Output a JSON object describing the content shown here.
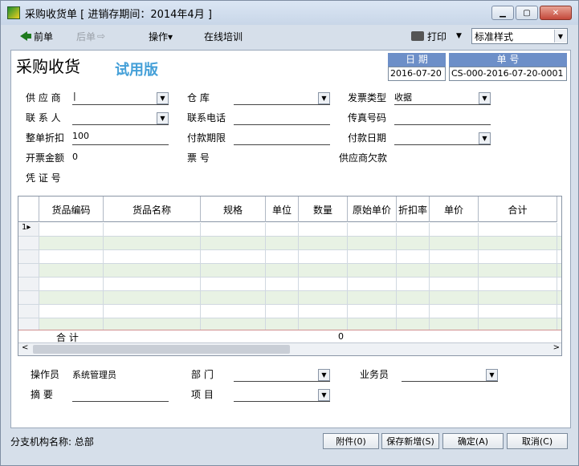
{
  "window": {
    "title": "采购收货单 [ 进销存期间：2014年4月 ]"
  },
  "toolbar": {
    "prev": "前单",
    "next": "后单",
    "operate": "操作▾",
    "training": "在线培训",
    "print": "打印",
    "style_value": "标准样式"
  },
  "header": {
    "form_title": "采购收货",
    "trial": "试用版",
    "date_label": "日 期",
    "date_value": "2016-07-20",
    "no_label": "单 号",
    "no_value": "CS-000-2016-07-20-0001"
  },
  "fields": {
    "supplier": "供 应 商",
    "warehouse": "仓      库",
    "invoice_type": "发票类型",
    "invoice_type_value": "收据",
    "contact": "联 系 人",
    "phone": "联系电话",
    "fax": "传真号码",
    "discount": "整单折扣",
    "discount_value": "100",
    "pay_term": "付款期限",
    "pay_date": "付款日期",
    "invoice_amount": "开票金额",
    "invoice_amount_value": "0",
    "ticket_no": "票      号",
    "supplier_debt": "供应商欠款",
    "voucher": "凭 证 号"
  },
  "grid": {
    "columns": [
      "货品编码",
      "货品名称",
      "规格",
      "单位",
      "数量",
      "原始单价",
      "折扣率",
      "单价",
      "合计"
    ],
    "row_indicator": "1",
    "total_label": "合 计",
    "total_qty": "0"
  },
  "footer": {
    "operator": "操作员",
    "operator_value": "系统管理员",
    "dept": "部    门",
    "salesman": "业务员",
    "summary": "摘    要",
    "project": "项    目"
  },
  "status": {
    "branch": "分支机构名称: 总部",
    "attach": "附件(0)",
    "save_new": "保存新增(S)",
    "ok": "确定(A)",
    "cancel": "取消(C)"
  },
  "icons": {
    "prev": "arrow-left-icon",
    "next": "arrow-right-icon",
    "print": "printer-icon"
  }
}
